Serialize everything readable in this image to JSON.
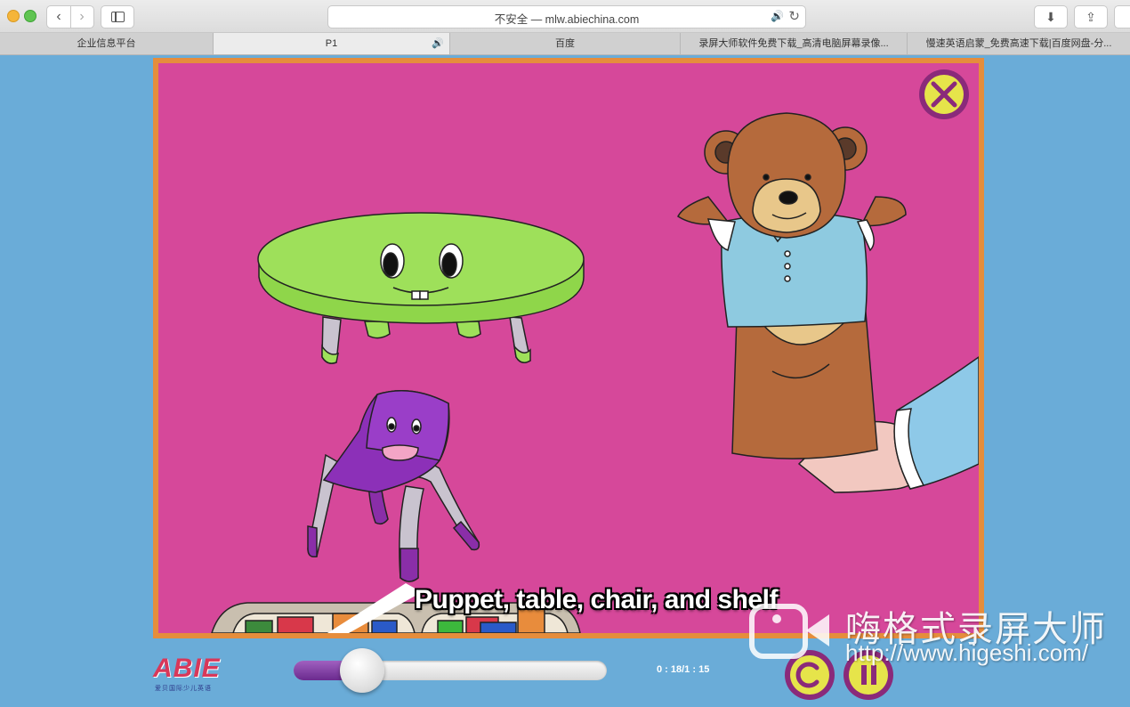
{
  "browser": {
    "url_text": "不安全 — mlw.abiechina.com",
    "tabs": [
      {
        "label": "企业信息平台"
      },
      {
        "label": "P1"
      },
      {
        "label": "百度"
      },
      {
        "label": "录屏大师软件免费下载_高清电脑屏幕录像..."
      },
      {
        "label": "慢速英语启蒙_免费高速下载|百度网盘-分..."
      }
    ],
    "icons": {
      "back": "‹",
      "forward": "›",
      "sound": "🔊",
      "reload": "↻",
      "download": "⬇",
      "share": "⇪"
    }
  },
  "lesson": {
    "subtitle": "Puppet, table, chair, and shelf"
  },
  "player": {
    "logo": "ABIE",
    "logo_sub": "爱贝国际少儿英语",
    "time": "0 : 18/1 : 15",
    "progress": 0.22
  },
  "watermark": {
    "title": "嗨格式录屏大师",
    "url": "http://www.higeshi.com/"
  },
  "colors": {
    "stage_bg": "#d6489a",
    "stage_border": "#e58d3c",
    "page_bg": "#6aacd8",
    "button_ring": "#8a2a7a",
    "button_face": "#e6e44a"
  }
}
